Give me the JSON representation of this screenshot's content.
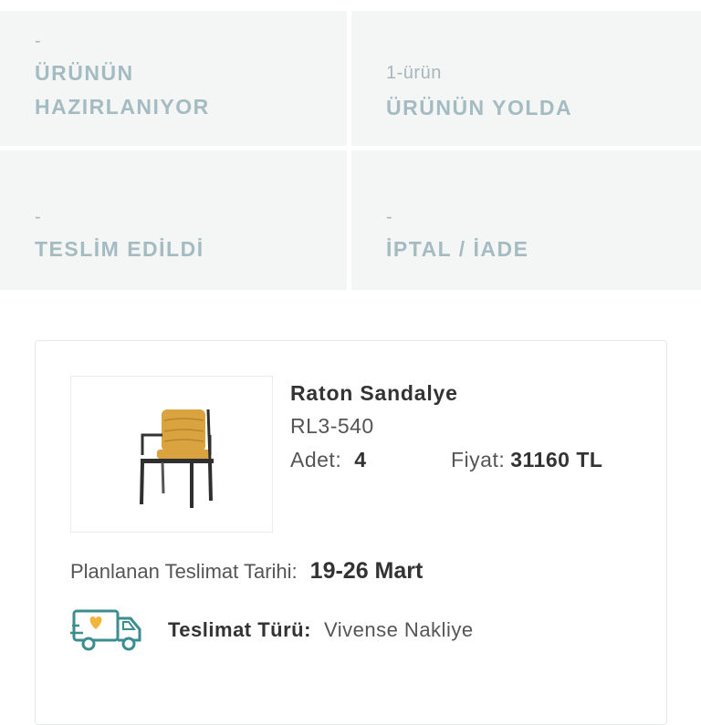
{
  "status_tiles": [
    {
      "count": "-",
      "label_line1": "ÜRÜNÜN",
      "label_line2": "HAZIRLANIYOR"
    },
    {
      "count": "1-ürün",
      "label_line1": "ÜRÜNÜN YOLDA"
    },
    {
      "count": "-",
      "label_line1": "TESLİM EDİLDİ"
    },
    {
      "count": "-",
      "label_line1": "İPTAL / İADE"
    }
  ],
  "order_item": {
    "name": "Raton Sandalye",
    "sku": "RL3-540",
    "quantity_label": "Adet:",
    "quantity_value": "4",
    "price_label": "Fiyat:",
    "price_value": "31160 TL",
    "image_icon": "chair-image"
  },
  "delivery": {
    "date_label": "Planlanan Teslimat Tarihi:",
    "date_value": "19-26 Mart",
    "type_label": "Teslimat Türü:",
    "type_value": "Vivense Nakliye",
    "icon": "delivery-truck-icon"
  },
  "colors": {
    "tile_bg": "#f4f5f5",
    "tile_text": "#a4bcc1",
    "truck_accent": "#f3b43b",
    "truck_outline": "#3b8d91"
  }
}
